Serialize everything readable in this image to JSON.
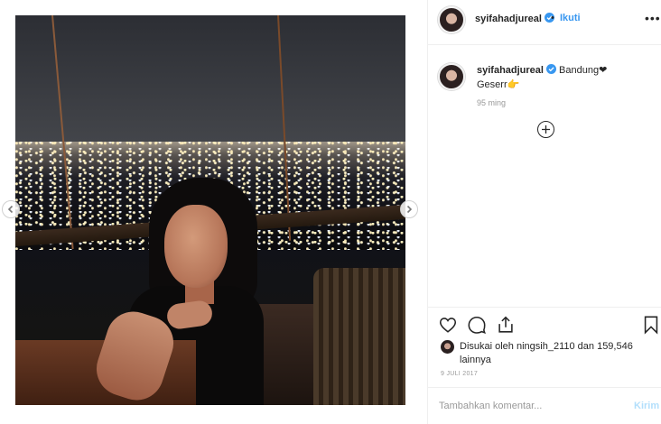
{
  "post": {
    "username": "syifahadjureal",
    "follow_label": "Ikuti",
    "separator": "•",
    "more_icon": "•••"
  },
  "caption": {
    "username": "syifahadjureal",
    "text_line1": "Bandung❤",
    "text_line2": "Geserr👉",
    "time_ago": "95 ming"
  },
  "likes": {
    "text": "Disukai oleh ningsih_2110 dan 159,546 lainnya"
  },
  "date": "9 JULI 2017",
  "comment": {
    "placeholder": "Tambahkan komentar...",
    "post_label": "Kirim"
  },
  "colors": {
    "link_blue": "#3897f0",
    "post_disabled": "#b2dffc",
    "muted": "#999999"
  }
}
